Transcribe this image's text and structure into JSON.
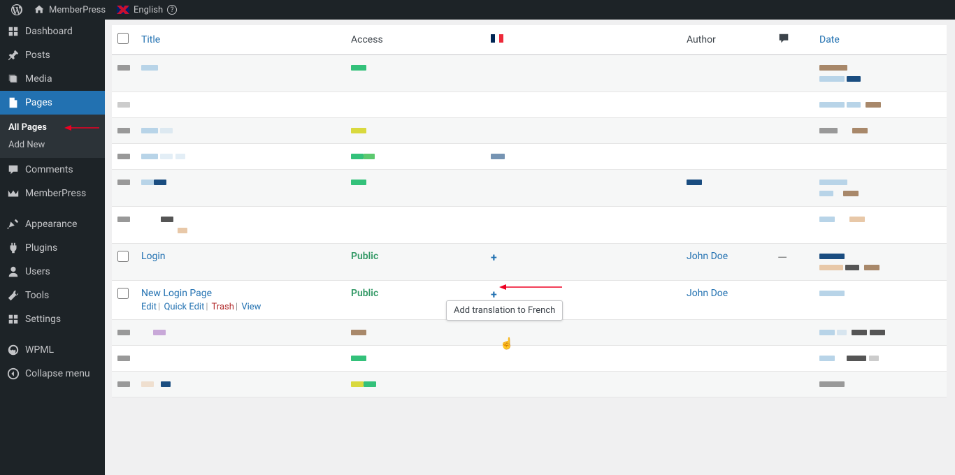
{
  "topbar": {
    "site": "MemberPress",
    "lang": "English"
  },
  "sidebar": {
    "dashboard": "Dashboard",
    "posts": "Posts",
    "media": "Media",
    "pages": "Pages",
    "all_pages": "All Pages",
    "add_new": "Add New",
    "comments": "Comments",
    "memberpress": "MemberPress",
    "appearance": "Appearance",
    "plugins": "Plugins",
    "users": "Users",
    "tools": "Tools",
    "settings": "Settings",
    "wpml": "WPML",
    "collapse": "Collapse menu"
  },
  "table": {
    "headers": {
      "title": "Title",
      "access": "Access",
      "author": "Author",
      "date": "Date"
    }
  },
  "rows": {
    "login": {
      "title": "Login",
      "access": "Public",
      "author": "John Doe",
      "comments_dash": "—"
    },
    "newlogin": {
      "title": "New Login Page",
      "access": "Public",
      "author": "John Doe",
      "edit": "Edit",
      "quick_edit": "Quick Edit",
      "trash": "Trash",
      "view": "View"
    }
  },
  "tooltip": "Add translation to French"
}
